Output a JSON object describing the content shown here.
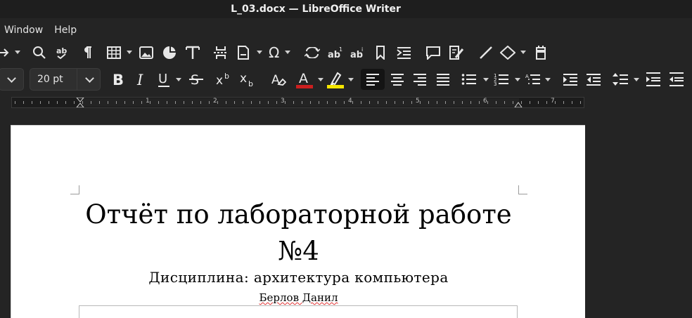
{
  "window": {
    "title": "L_03.docx — LibreOffice Writer"
  },
  "menubar": {
    "items": [
      "Window",
      "Help"
    ]
  },
  "formatting": {
    "font_size": "20 pt",
    "colors": {
      "font_color": "#cc1f1f",
      "highlight_color": "#f5e600",
      "accent": "#141414"
    }
  },
  "ruler": {
    "numbers": [
      "1",
      "2",
      "3",
      "4",
      "5",
      "6",
      "7"
    ]
  },
  "document": {
    "title_line1": "Отчёт по лабораторной работе",
    "title_line2": "№4",
    "subtitle": "Дисциплина: архитектура компьютера",
    "author": "Берлов Данил"
  },
  "icons": [
    "arrow-right-icon",
    "search-icon",
    "spelling-icon",
    "pilcrow-icon",
    "table-icon",
    "image-icon",
    "chart-icon",
    "textbox-icon",
    "page-break-icon",
    "field-icon",
    "special-char-icon",
    "cross-ref-icon",
    "footnote-icon",
    "endnote-icon",
    "bookmark-icon",
    "reference-icon",
    "comment-icon",
    "track-changes-icon",
    "line-icon",
    "shapes-icon",
    "insert-draw-icon"
  ]
}
